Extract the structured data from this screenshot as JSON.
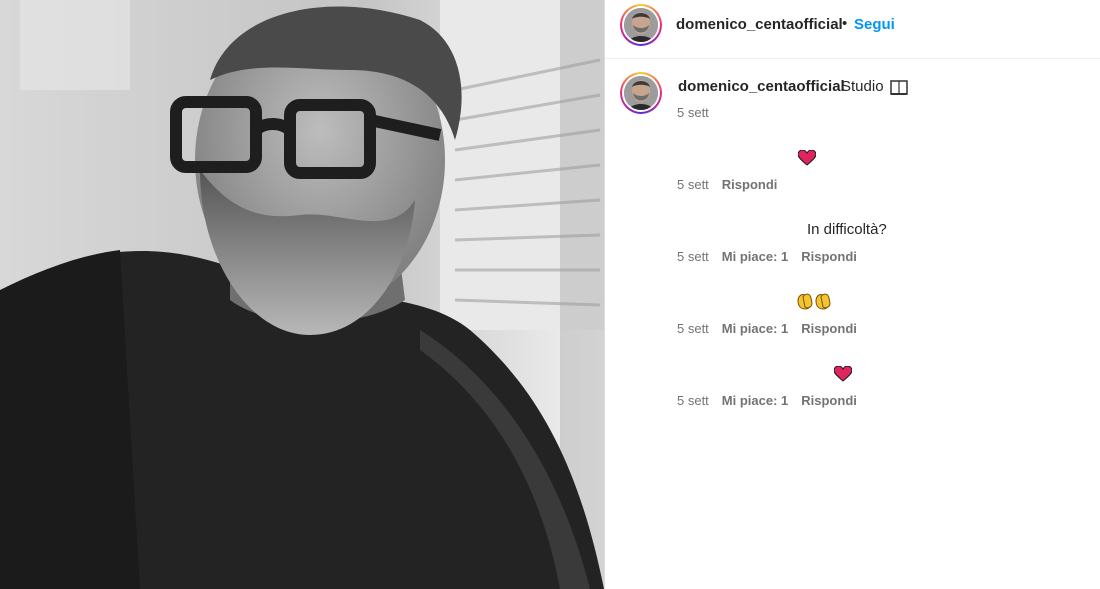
{
  "post": {
    "author": "domenico_centaofficial",
    "follow_label": "Segui",
    "separator": "•"
  },
  "caption": {
    "author": "domenico_centaofficial",
    "text": "Studio",
    "emoji_icon": "open-book-icon",
    "time": "5 sett"
  },
  "comments": [
    {
      "text": "",
      "emoji": "heart",
      "time": "5 sett",
      "likes": "",
      "reply": "Rispondi"
    },
    {
      "text": "In difficoltà?",
      "emoji": "",
      "time": "5 sett",
      "likes": "Mi piace: 1",
      "reply": "Rispondi"
    },
    {
      "text": "",
      "emoji": "clapping-hands",
      "time": "5 sett",
      "likes": "Mi piace: 1",
      "reply": "Rispondi"
    },
    {
      "text": "",
      "emoji": "heart",
      "time": "5 sett",
      "likes": "Mi piace: 1",
      "reply": "Rispondi"
    }
  ],
  "colors": {
    "follow": "#0095f6",
    "meta": "#737373",
    "heart": "#e0245e"
  }
}
